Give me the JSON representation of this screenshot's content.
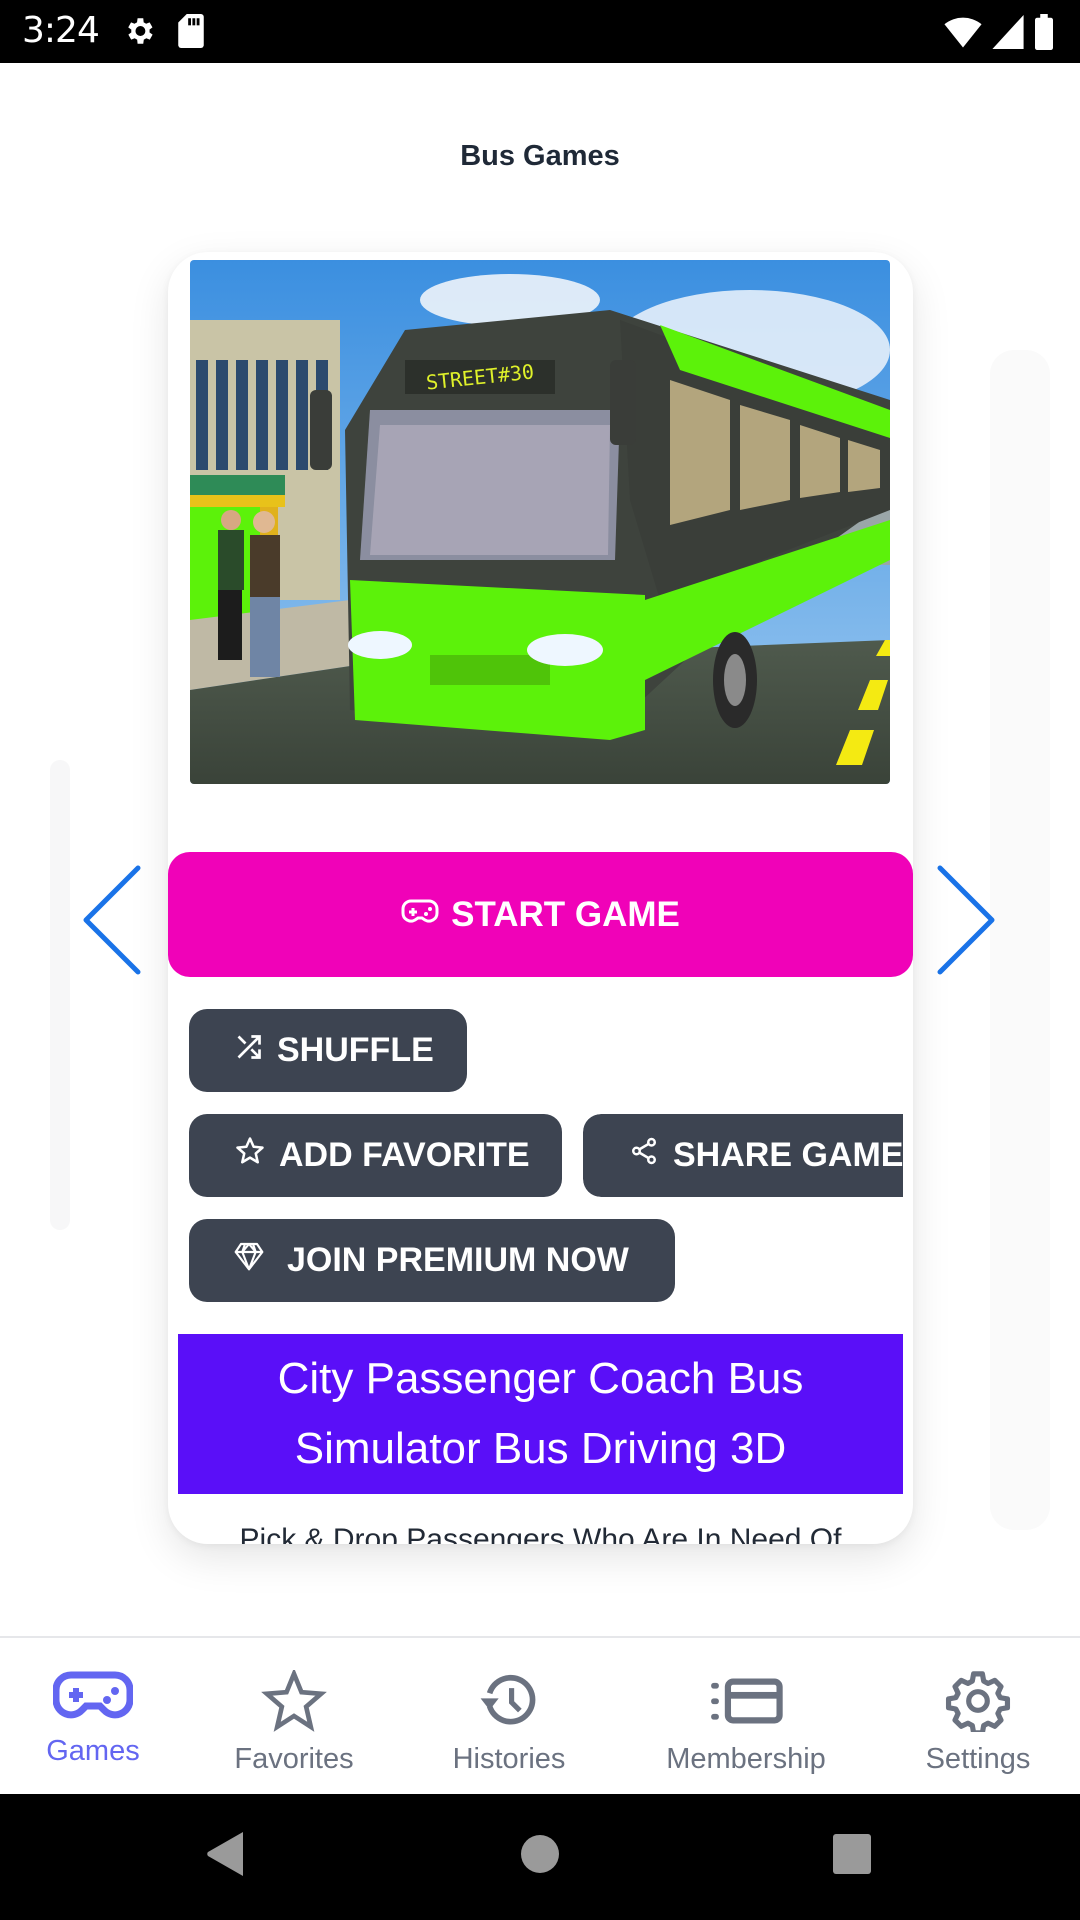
{
  "status_bar": {
    "time": "3:24",
    "icons": [
      "gear-icon",
      "sd-card-icon",
      "wifi-icon",
      "cellular-signal-icon",
      "battery-icon"
    ]
  },
  "header": {
    "title": "Bus Games"
  },
  "game_card": {
    "image_alt": "City Passenger Coach Bus Simulator - green bus labelled STREET#30",
    "image_sign_text": "STREET#30",
    "start_button": {
      "label": "START GAME",
      "icon": "gamepad-icon"
    },
    "shuffle_button": {
      "label": "SHUFFLE",
      "icon": "shuffle-icon"
    },
    "favorite_button": {
      "label": "ADD FAVORITE",
      "icon": "star-icon"
    },
    "share_button": {
      "label": "SHARE GAME",
      "icon": "share-icon"
    },
    "premium_button": {
      "label": "JOIN PREMIUM NOW",
      "icon": "diamond-icon"
    },
    "title": "City Passenger Coach Bus Simulator Bus Driving 3D",
    "description": "Pick & Drop Passengers Who Are In Need Of Transport To Reach Their Destinations In All Hurry"
  },
  "carousel": {
    "prev_icon": "chevron-left-icon",
    "next_icon": "chevron-right-icon"
  },
  "bottom_nav": {
    "items": [
      {
        "label": "Games",
        "icon": "gamepad-icon",
        "active": true
      },
      {
        "label": "Favorites",
        "icon": "star-icon",
        "active": false
      },
      {
        "label": "Histories",
        "icon": "history-icon",
        "active": false
      },
      {
        "label": "Membership",
        "icon": "membership-card-icon",
        "active": false
      },
      {
        "label": "Settings",
        "icon": "gear-icon",
        "active": false
      }
    ]
  },
  "colors": {
    "start_button": "#f002b8",
    "action_button": "#3d4451",
    "title_box": "#5a0ff8",
    "nav_active": "#6366f1",
    "nav_inactive": "#6b7280",
    "carousel_arrow": "#1a73e8"
  }
}
